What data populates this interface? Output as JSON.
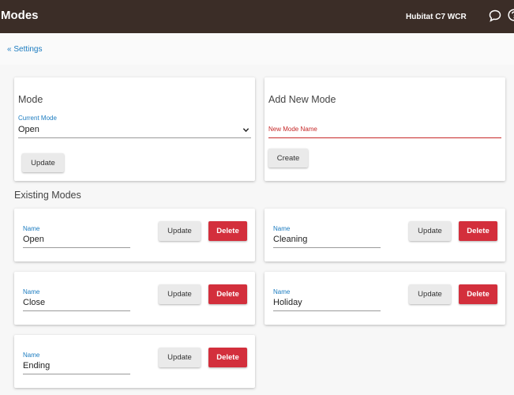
{
  "header": {
    "title": "Modes",
    "hub_name": "Hubitat C7 WCR",
    "icons": [
      "chat-icon",
      "help-icon"
    ]
  },
  "breadcrumb": {
    "back_label": "« Settings"
  },
  "mode_card": {
    "title": "Mode",
    "current_label": "Current Mode",
    "current_value": "Open",
    "update_label": "Update"
  },
  "add_card": {
    "title": "Add New Mode",
    "name_label": "New Mode Name",
    "name_value": "",
    "create_label": "Create"
  },
  "existing": {
    "heading": "Existing Modes",
    "modes": [
      {
        "name_label": "Name",
        "name": "Open",
        "update": "Update",
        "delete": "Delete"
      },
      {
        "name_label": "Name",
        "name": "Cleaning",
        "update": "Update",
        "delete": "Delete"
      },
      {
        "name_label": "Name",
        "name": "Close",
        "update": "Update",
        "delete": "Delete"
      },
      {
        "name_label": "Name",
        "name": "Holiday",
        "update": "Update",
        "delete": "Delete"
      },
      {
        "name_label": "Name",
        "name": "Ending",
        "update": "Update",
        "delete": "Delete"
      }
    ]
  },
  "colors": {
    "header_bg": "#3b2d27",
    "link": "#1c7cc0",
    "danger": "#d32f3c",
    "required_line": "#c62828"
  }
}
